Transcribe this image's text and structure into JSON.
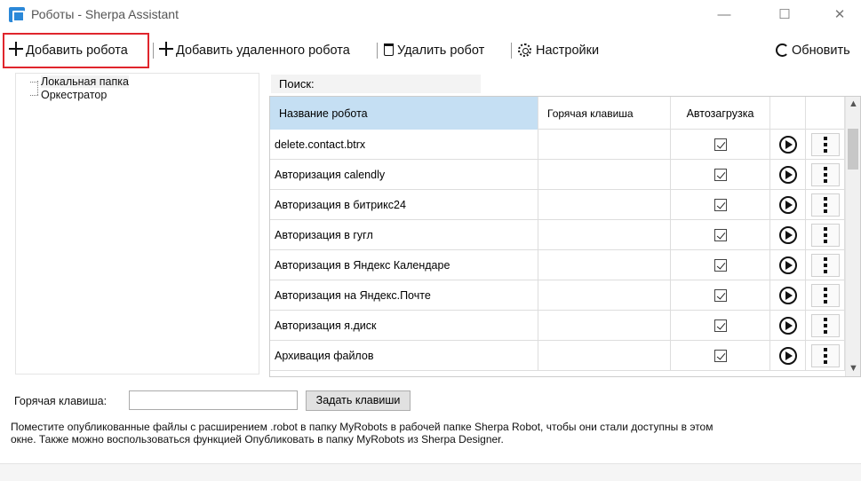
{
  "window": {
    "title": "Роботы - Sherpa Assistant",
    "minimize": "—",
    "maximize": "☐",
    "close": "✕"
  },
  "toolbar": {
    "add_robot": "Добавить робота",
    "add_remote_robot": "Добавить удаленного робота",
    "delete_robot": "Удалить робот",
    "settings": "Настройки",
    "refresh": "Обновить"
  },
  "tree": {
    "items": [
      "Локальная папка",
      "Оркестратор"
    ]
  },
  "search": {
    "label": "Поиск:"
  },
  "grid": {
    "columns": {
      "name": "Название робота",
      "hotkey": "Горячая клавиша",
      "autoload": "Автозагрузка"
    },
    "rows": [
      {
        "name": "delete.contact.btrx",
        "hotkey": "",
        "autoload": true
      },
      {
        "name": "Авторизация calendly",
        "hotkey": "",
        "autoload": true
      },
      {
        "name": "Авторизация в битрикс24",
        "hotkey": "",
        "autoload": true
      },
      {
        "name": "Авторизация в гугл",
        "hotkey": "",
        "autoload": true
      },
      {
        "name": "Авторизация в Яндекс Календаре",
        "hotkey": "",
        "autoload": true
      },
      {
        "name": "Авторизация на Яндекс.Почте",
        "hotkey": "",
        "autoload": true
      },
      {
        "name": "Авторизация я.диск",
        "hotkey": "",
        "autoload": true
      },
      {
        "name": "Архивация файлов",
        "hotkey": "",
        "autoload": true
      }
    ]
  },
  "bottom": {
    "hotkey_label": "Горячая клавиша:",
    "hotkey_value": "",
    "set_keys_button": "Задать клавиши",
    "hint_line1": "Поместите опубликованные файлы с расширением .robot в папку MyRobots в рабочей папке Sherpa Robot, чтобы они стали доступны в этом",
    "hint_line2": "окне. Также можно воспользоваться функцией Опубликовать в папку MyRobots из Sherpa Designer."
  },
  "colors": {
    "highlight": "#e0252c",
    "header_selected": "#c5dff3",
    "app_icon": "#2b88d8"
  }
}
